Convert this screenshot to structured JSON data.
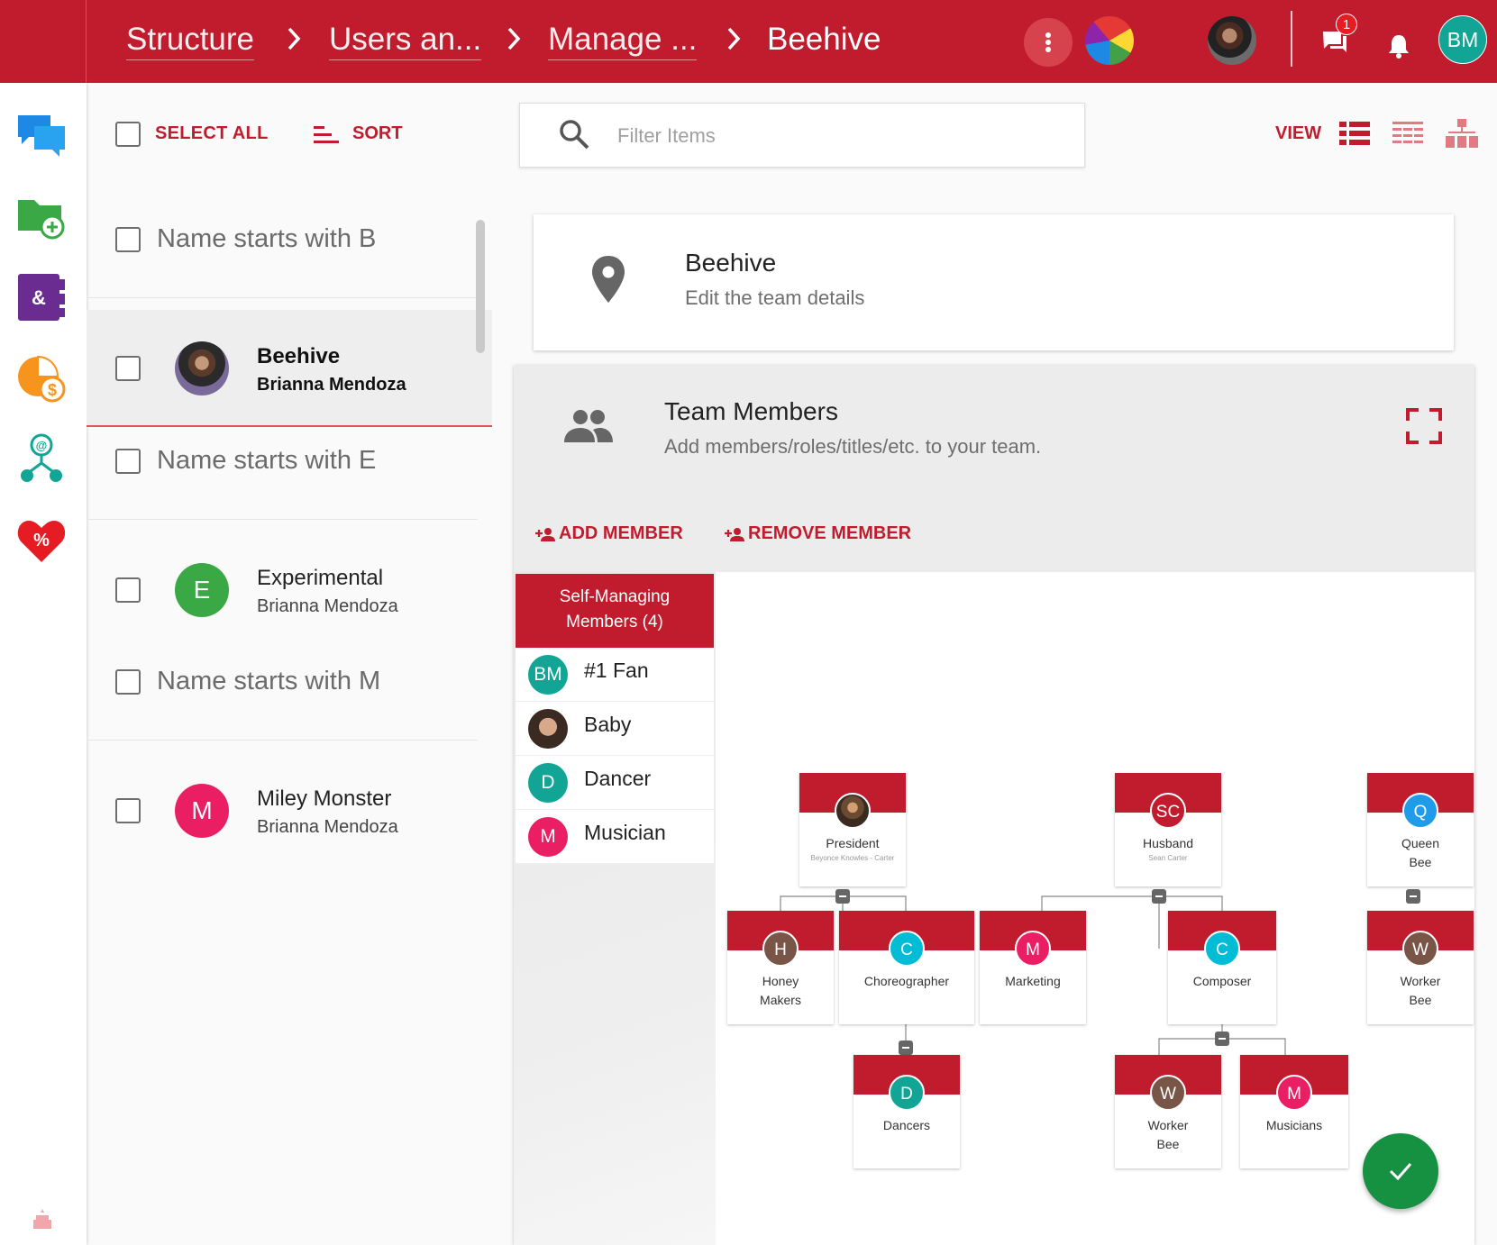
{
  "breadcrumbs": [
    "Structure",
    "Users an...",
    "Manage ...",
    "Beehive"
  ],
  "header": {
    "notification_count": "1",
    "user_initials": "BM",
    "accent_color": "#c01c2e"
  },
  "rail": {
    "icons": [
      "chat-icon",
      "folder-add-icon",
      "contacts-icon",
      "finance-chart-icon",
      "org-network-icon",
      "heart-percent-icon",
      "cake-icon"
    ]
  },
  "toolbar": {
    "select_all": "SELECT ALL",
    "sort": "SORT",
    "filter_placeholder": "Filter Items",
    "view": "VIEW"
  },
  "list": {
    "groups": [
      "Name starts with B",
      "Name starts with E",
      "Name starts with M"
    ],
    "items": [
      {
        "name": "Beehive",
        "owner": "Brianna Mendoza",
        "initial": "",
        "color": "#7a5a4a"
      },
      {
        "name": "Experimental",
        "owner": "Brianna Mendoza",
        "initial": "E",
        "color": "#3aa845"
      },
      {
        "name": "Miley Monster",
        "owner": "Brianna Mendoza",
        "initial": "M",
        "color": "#e91e63"
      }
    ]
  },
  "detail": {
    "title": "Beehive",
    "subtitle": "Edit the team details"
  },
  "team": {
    "title": "Team Members",
    "subtitle": "Add members/roles/titles/etc. to your team.",
    "add_member": "ADD MEMBER",
    "remove_member": "REMOVE MEMBER",
    "self_managing_line1": "Self-Managing",
    "self_managing_line2": "Members (4)",
    "members": [
      {
        "initials": "BM",
        "name": "#1 Fan",
        "color": "#12a596"
      },
      {
        "initials": "",
        "name": "Baby",
        "color": "#8a6a55"
      },
      {
        "initials": "D",
        "name": "Dancer",
        "color": "#12a596"
      },
      {
        "initials": "M",
        "name": "Musician",
        "color": "#e91e63"
      }
    ]
  },
  "org": {
    "president": {
      "label": "President",
      "sub": "Beyonce Knowles - Carter",
      "initial": "",
      "color": "#6b4a32"
    },
    "husband": {
      "label": "Husband",
      "sub": "Sean Carter",
      "initial": "SC",
      "color": "#c01c2e"
    },
    "queen": {
      "label_line1": "Queen",
      "label_line2": "Bee",
      "initial": "Q",
      "color": "#1e9be9"
    },
    "honey": {
      "label_line1": "Honey",
      "label_line2": "Makers",
      "initial": "H",
      "color": "#795548"
    },
    "choreographer": {
      "label": "Choreographer",
      "initial": "C",
      "color": "#00bcd4"
    },
    "marketing": {
      "label": "Marketing",
      "initial": "M",
      "color": "#e91e63"
    },
    "composer": {
      "label": "Composer",
      "initial": "C",
      "color": "#00bcd4"
    },
    "worker_bee_1": {
      "label_line1": "Worker",
      "label_line2": "Bee",
      "initial": "W",
      "color": "#795548"
    },
    "dancers": {
      "label": "Dancers",
      "initial": "D",
      "color": "#12a596"
    },
    "worker_bee_2": {
      "label_line1": "Worker",
      "label_line2": "Bee",
      "initial": "W",
      "color": "#795548"
    },
    "musicians": {
      "label": "Musicians",
      "initial": "M",
      "color": "#e91e63"
    }
  }
}
